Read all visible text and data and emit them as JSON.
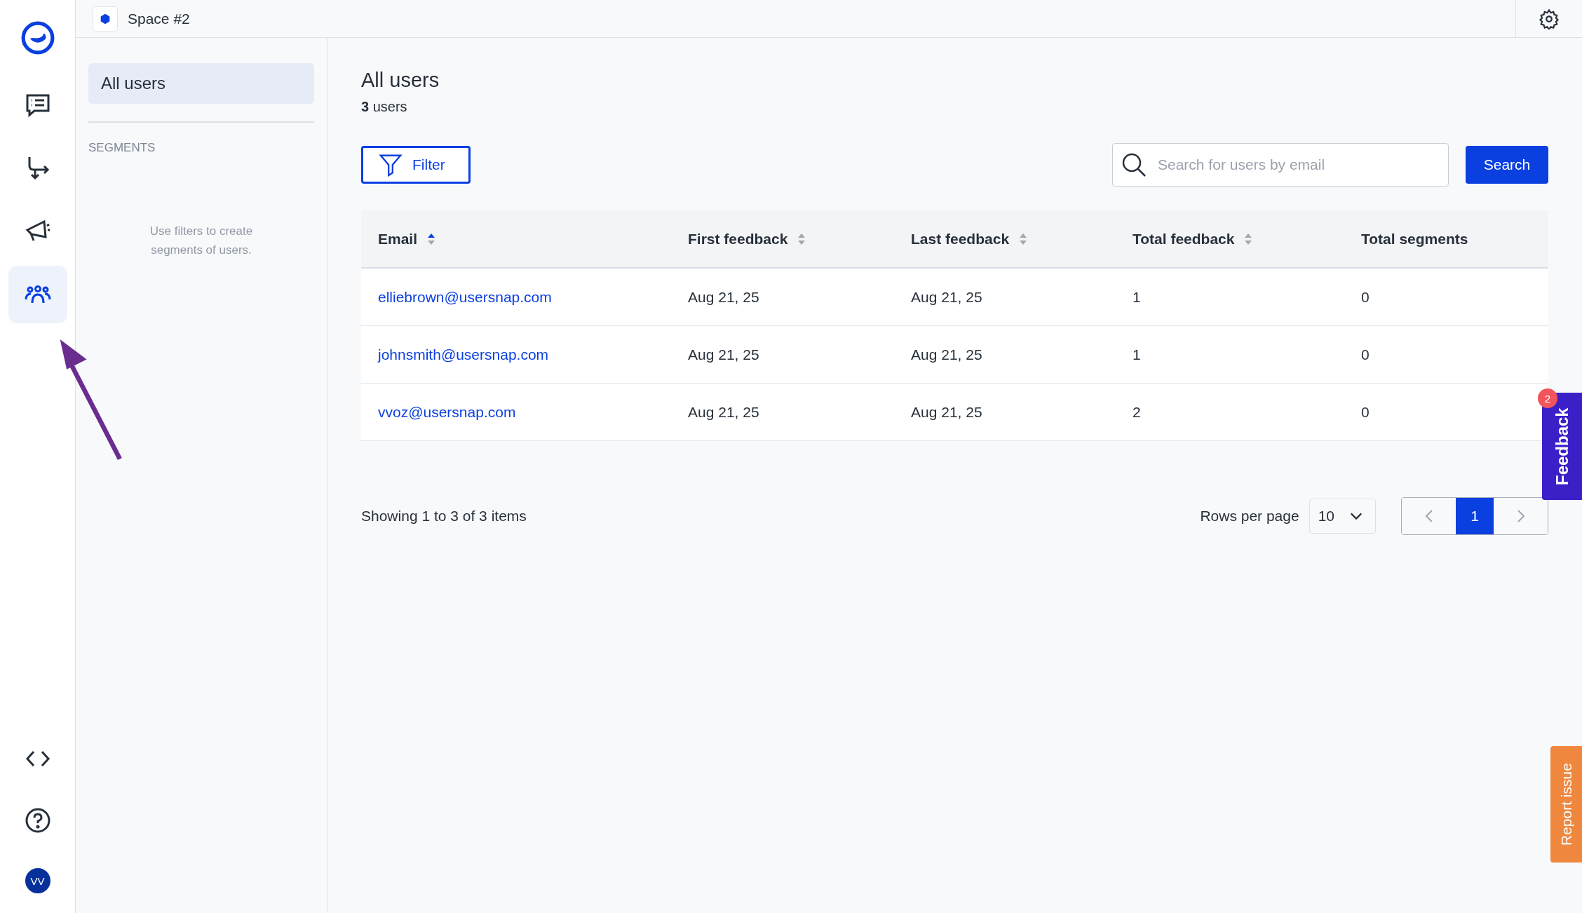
{
  "rail": {
    "items": [
      {
        "kind": "feedback",
        "selected": false
      },
      {
        "kind": "flows",
        "selected": false
      },
      {
        "kind": "announcements",
        "selected": false
      },
      {
        "kind": "users",
        "selected": true
      }
    ],
    "bottom": [
      {
        "kind": "code"
      },
      {
        "kind": "help"
      }
    ],
    "avatar": "VV"
  },
  "topbar": {
    "space": "Space #2"
  },
  "sidebar": {
    "items": [
      {
        "label": "All users",
        "selected": true
      }
    ],
    "section": "SEGMENTS",
    "empty": "Use filters to create segments of users."
  },
  "main": {
    "title": "All users",
    "count": "3",
    "count_label": "users",
    "filter": "Filter",
    "search": {
      "placeholder": "Search for users by email",
      "button": "Search"
    }
  },
  "table": {
    "columns": [
      {
        "label": "Email",
        "kind": "sortable",
        "sorted": true
      },
      {
        "label": "First feedback",
        "kind": "sortable",
        "sorted": false
      },
      {
        "label": "Last feedback",
        "kind": "sortable",
        "sorted": false
      },
      {
        "label": "Total feedback",
        "kind": "sortable",
        "sorted": false
      },
      {
        "label": "Total segments",
        "kind": "plain"
      }
    ],
    "rows": [
      [
        "elliebrown@usersnap.com",
        "Aug 21, 25",
        "Aug 21, 25",
        "1",
        "0"
      ],
      [
        "johnsmith@usersnap.com",
        "Aug 21, 25",
        "Aug 21, 25",
        "1",
        "0"
      ],
      [
        "vvoz@usersnap.com",
        "Aug 21, 25",
        "Aug 21, 25",
        "2",
        "0"
      ]
    ]
  },
  "footer": {
    "showing": "Showing 1 to 3 of 3 items",
    "rows_label": "Rows per page",
    "rows_value": "10",
    "pages": [
      {
        "label": "1",
        "selected": true
      }
    ]
  },
  "widgets": {
    "feedback": "Feedback",
    "feedback_badge": "2",
    "report": "Report issue"
  }
}
